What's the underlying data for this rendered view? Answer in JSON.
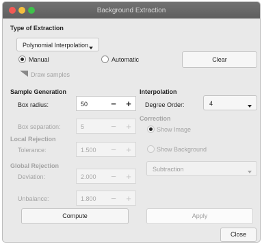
{
  "window": {
    "title": "Background Extraction"
  },
  "extraction": {
    "heading": "Type of Extraction",
    "method_selected": "Polynomial Interpolation",
    "manual_label": "Manual",
    "automatic_label": "Automatic",
    "mode": "Manual",
    "clear_label": "Clear",
    "draw_samples_label": "Draw samples"
  },
  "sample_generation": {
    "heading": "Sample Generation",
    "box_radius_label": "Box radius:",
    "box_radius_value": "50",
    "box_separation_label": "Box separation:",
    "box_separation_value": "5"
  },
  "local_rejection": {
    "heading": "Local Rejection",
    "tolerance_label": "Tolerance:",
    "tolerance_value": "1.500"
  },
  "global_rejection": {
    "heading": "Global Rejection",
    "deviation_label": "Deviation:",
    "deviation_value": "2.000",
    "unbalance_label": "Unbalance:",
    "unbalance_value": "1.800"
  },
  "interpolation": {
    "heading": "Interpolation",
    "degree_label": "Degree Order:",
    "degree_value": "4"
  },
  "correction": {
    "heading": "Correction",
    "show_image_label": "Show Image",
    "show_background_label": "Show Background",
    "mode_value": "Subtraction"
  },
  "stepper": {
    "minus": "−",
    "plus": "+"
  },
  "actions": {
    "compute": "Compute",
    "apply": "Apply",
    "close": "Close"
  }
}
